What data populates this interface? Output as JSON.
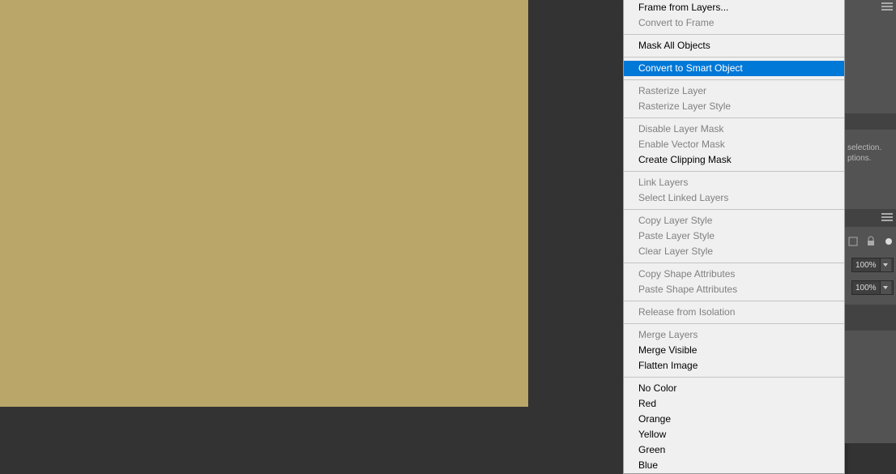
{
  "canvas": {
    "color": "#bba66a"
  },
  "contextMenu": {
    "groups": [
      [
        {
          "label": "Frame from Layers...",
          "state": "enabled"
        },
        {
          "label": "Convert to Frame",
          "state": "disabled"
        }
      ],
      [
        {
          "label": "Mask All Objects",
          "state": "enabled"
        }
      ],
      [
        {
          "label": "Convert to Smart Object",
          "state": "highlighted"
        }
      ],
      [
        {
          "label": "Rasterize Layer",
          "state": "disabled"
        },
        {
          "label": "Rasterize Layer Style",
          "state": "disabled"
        }
      ],
      [
        {
          "label": "Disable Layer Mask",
          "state": "disabled"
        },
        {
          "label": "Enable Vector Mask",
          "state": "disabled"
        },
        {
          "label": "Create Clipping Mask",
          "state": "enabled"
        }
      ],
      [
        {
          "label": "Link Layers",
          "state": "disabled"
        },
        {
          "label": "Select Linked Layers",
          "state": "disabled"
        }
      ],
      [
        {
          "label": "Copy Layer Style",
          "state": "disabled"
        },
        {
          "label": "Paste Layer Style",
          "state": "disabled"
        },
        {
          "label": "Clear Layer Style",
          "state": "disabled"
        }
      ],
      [
        {
          "label": "Copy Shape Attributes",
          "state": "disabled"
        },
        {
          "label": "Paste Shape Attributes",
          "state": "disabled"
        }
      ],
      [
        {
          "label": "Release from Isolation",
          "state": "disabled"
        }
      ],
      [
        {
          "label": "Merge Layers",
          "state": "disabled"
        },
        {
          "label": "Merge Visible",
          "state": "enabled"
        },
        {
          "label": "Flatten Image",
          "state": "enabled"
        }
      ],
      [
        {
          "label": "No Color",
          "state": "enabled"
        },
        {
          "label": "Red",
          "state": "enabled"
        },
        {
          "label": "Orange",
          "state": "enabled"
        },
        {
          "label": "Yellow",
          "state": "enabled"
        },
        {
          "label": "Green",
          "state": "enabled"
        },
        {
          "label": "Blue",
          "state": "enabled"
        }
      ]
    ]
  },
  "panel": {
    "info1": "selection.",
    "info2": "ptions.",
    "opacity": "100%",
    "fill": "100%"
  }
}
